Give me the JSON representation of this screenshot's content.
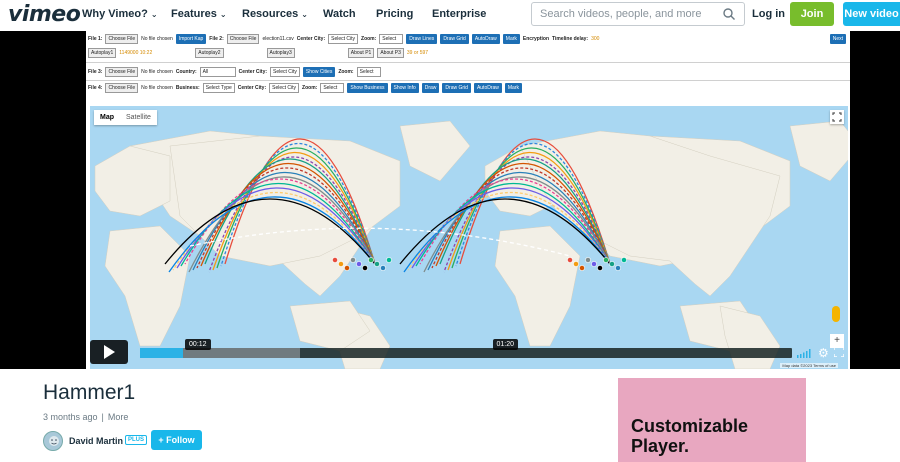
{
  "header": {
    "logo": "vimeo",
    "nav": [
      {
        "label": "Why Vimeo?",
        "dropdown": true
      },
      {
        "label": "Features",
        "dropdown": true
      },
      {
        "label": "Resources",
        "dropdown": true
      },
      {
        "label": "Watch",
        "dropdown": false
      },
      {
        "label": "Pricing",
        "dropdown": false
      },
      {
        "label": "Enterprise",
        "dropdown": false
      }
    ],
    "search_placeholder": "Search videos, people, and more",
    "login": "Log in",
    "join": "Join",
    "new_video": "New video"
  },
  "app": {
    "row1": {
      "file1_label": "File 1:",
      "choose": "Choose File",
      "no_file": "No file chosen",
      "import_btn": "Import Kap",
      "file2_label": "File 2:",
      "file2_name": "election11.csv",
      "center_city": "Center City:",
      "select_city": "Select City",
      "zoom": "Zoom:",
      "select": "Select",
      "btns": [
        "Draw Lines",
        "Draw Grid",
        "AutoDraw",
        "Mark"
      ],
      "encryption": "Encryption",
      "timeline": "Timeline delay:",
      "timeline_val": "300",
      "next": "Next"
    },
    "row2": {
      "autoplay1": "Autoplay1",
      "autoplay1_val": "1149000 10:22",
      "autoplay2": "Autoplay2",
      "autoplay3": "Autoplay3",
      "about1": "About P1",
      "about3": "About P3",
      "about_val": "39 or 597"
    },
    "row3": {
      "file3_label": "File 3:",
      "country": "Country:",
      "country_val": "All",
      "center_city": "Center City:",
      "select_city": "Select City",
      "show_cities": "Show Cities",
      "zoom": "Zoom:",
      "select": "Select"
    },
    "row4": {
      "file4_label": "File 4:",
      "business": "Business:",
      "select_type": "Select Type",
      "center_city": "Center City:",
      "select_city": "Select City",
      "zoom": "Zoom:",
      "select": "Select",
      "btns": [
        "Show Business",
        "Show Info",
        "Draw",
        "Draw Grid",
        "AutoDraw",
        "Mark"
      ]
    },
    "map_tabs": [
      "Map",
      "Satellite"
    ],
    "map_footer": "Map data ©2023   Terms of use"
  },
  "player": {
    "current_time": "00:12",
    "hover_time": "01:20",
    "played_fraction": 0.066,
    "loaded_fraction": 0.245,
    "hover_fraction": 0.556
  },
  "video": {
    "title": "Hammer1",
    "age": "3 months ago",
    "more": "More",
    "author": "David Martin",
    "badge": "PLUS",
    "follow": "+ Follow"
  },
  "ad": {
    "line1": "Customizable",
    "line2": "Player."
  },
  "colors": {
    "brand_blue": "#19b7ea",
    "join_green": "#78bd2c",
    "ad_pink": "#e8a7c0"
  }
}
